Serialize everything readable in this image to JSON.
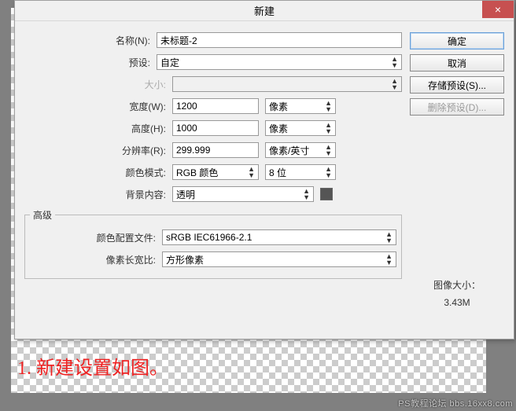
{
  "dialog": {
    "title": "新建",
    "close": "×",
    "buttons": {
      "ok": "确定",
      "cancel": "取消",
      "save_preset": "存储预设(S)...",
      "delete_preset": "删除预设(D)..."
    },
    "fields": {
      "name_label": "名称(N):",
      "name_value": "未标题-2",
      "preset_label": "预设:",
      "preset_value": "自定",
      "size_label": "大小:",
      "width_label": "宽度(W):",
      "width_value": "1200",
      "width_unit": "像素",
      "height_label": "高度(H):",
      "height_value": "1000",
      "height_unit": "像素",
      "res_label": "分辨率(R):",
      "res_value": "299.999",
      "res_unit": "像素/英寸",
      "mode_label": "颜色模式:",
      "mode_value": "RGB 颜色",
      "depth_value": "8 位",
      "bg_label": "背景内容:",
      "bg_value": "透明"
    },
    "advanced": {
      "legend": "高级",
      "profile_label": "颜色配置文件:",
      "profile_value": "sRGB IEC61966-2.1",
      "aspect_label": "像素长宽比:",
      "aspect_value": "方形像素"
    },
    "image_size": {
      "label": "图像大小：",
      "value": "3.43M"
    }
  },
  "caption": "1. 新建设置如图。",
  "watermark": "PS教程论坛 bbs.16xx8.com"
}
